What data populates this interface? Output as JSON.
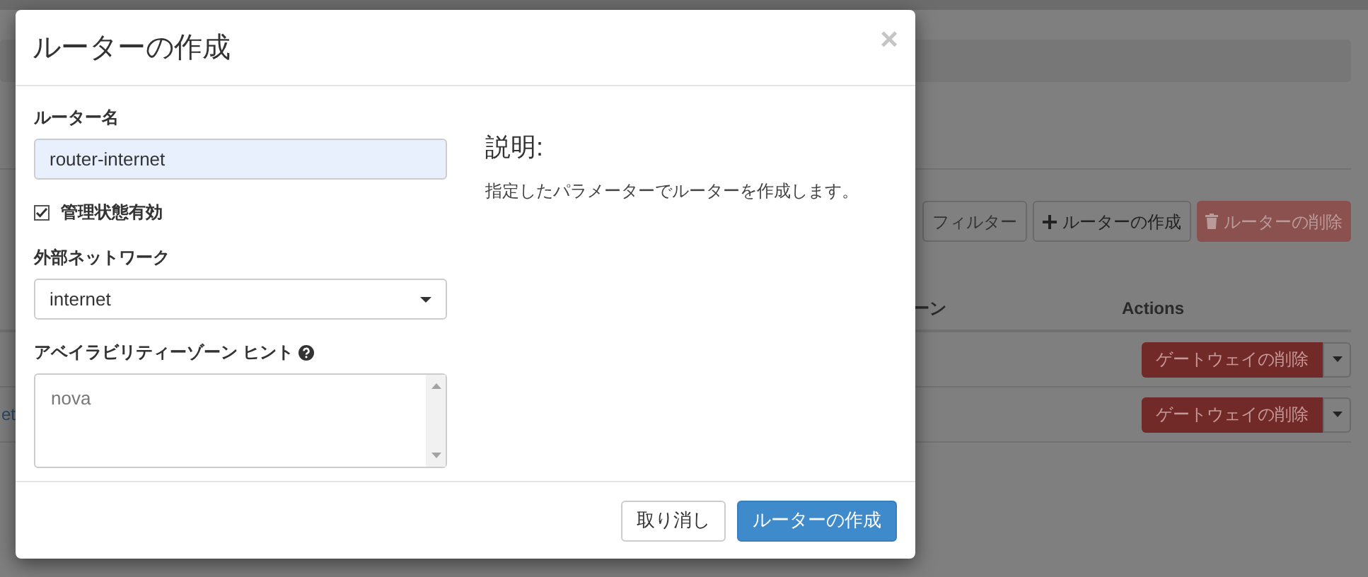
{
  "background": {
    "toolbar": [
      {
        "label": "フィルター",
        "kind": "plain",
        "disabled": false
      },
      {
        "label": "ルーターの作成",
        "kind": "create",
        "disabled": false
      },
      {
        "label": "ルーターの削除",
        "kind": "delete",
        "disabled": true
      }
    ],
    "table": {
      "columns": [
        "ーン",
        "Actions"
      ],
      "rows": [
        {
          "column_1": "",
          "action": "ゲートウェイの削除"
        },
        {
          "column_1": "et",
          "action": "ゲートウェイの削除"
        }
      ]
    }
  },
  "dialog": {
    "title": "ルーターの作成",
    "close": "×",
    "fields": [
      {
        "kind": "text",
        "label": "ルーター名",
        "value": "router-internet"
      },
      {
        "kind": "checkbox",
        "label": "管理状態有効",
        "checked": true
      },
      {
        "kind": "select",
        "label": "外部ネットワーク",
        "value": "internet"
      },
      {
        "kind": "textarea",
        "label": "アベイラビリティーゾーン ヒント",
        "help": true,
        "placeholder": "nova"
      }
    ],
    "description": {
      "heading": "説明:",
      "text": "指定したパラメーターでルーターを作成します。"
    },
    "buttons": [
      {
        "label": "取り消し",
        "kind": "secondary"
      },
      {
        "label": "ルーターの作成",
        "kind": "primary"
      }
    ]
  }
}
